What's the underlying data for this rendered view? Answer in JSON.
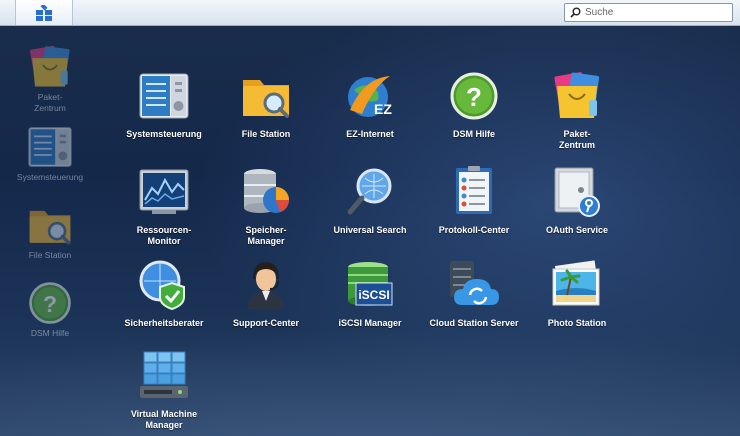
{
  "topbar": {
    "search_placeholder": "Suche"
  },
  "desktop_shortcuts": [
    {
      "label": "Paket-\nZentrum",
      "icon": "package-center-icon"
    },
    {
      "label": "Systemsteuerung",
      "icon": "control-panel-icon"
    },
    {
      "label": "File Station",
      "icon": "file-station-icon"
    },
    {
      "label": "DSM Hilfe",
      "icon": "help-icon"
    }
  ],
  "apps": [
    {
      "label": "Systemsteuerung",
      "icon": "control-panel-icon"
    },
    {
      "label": "File Station",
      "icon": "file-station-icon"
    },
    {
      "label": "EZ-Internet",
      "icon": "ez-internet-icon"
    },
    {
      "label": "DSM Hilfe",
      "icon": "help-icon"
    },
    {
      "label": "Paket-\nZentrum",
      "icon": "package-center-icon"
    },
    {
      "label": "Ressourcen-\nMonitor",
      "icon": "resource-monitor-icon"
    },
    {
      "label": "Speicher-\nManager",
      "icon": "storage-manager-icon"
    },
    {
      "label": "Universal Search",
      "icon": "universal-search-icon"
    },
    {
      "label": "Protokoll-Center",
      "icon": "log-center-icon"
    },
    {
      "label": "OAuth Service",
      "icon": "oauth-service-icon"
    },
    {
      "label": "Sicherheitsberater",
      "icon": "security-advisor-icon"
    },
    {
      "label": "Support-Center",
      "icon": "support-center-icon"
    },
    {
      "label": "iSCSI Manager",
      "icon": "iscsi-manager-icon"
    },
    {
      "label": "Cloud Station Server",
      "icon": "cloud-station-server-icon"
    },
    {
      "label": "Photo Station",
      "icon": "photo-station-icon"
    },
    {
      "label": "Virtual Machine\nManager",
      "icon": "virtual-machine-manager-icon"
    }
  ],
  "colors": {
    "desktop_bg": "#1a2d4c",
    "topbar_bg": "#e3eaf3",
    "label_text": "#ffffff",
    "shortcut_text": "#d6dde8"
  }
}
